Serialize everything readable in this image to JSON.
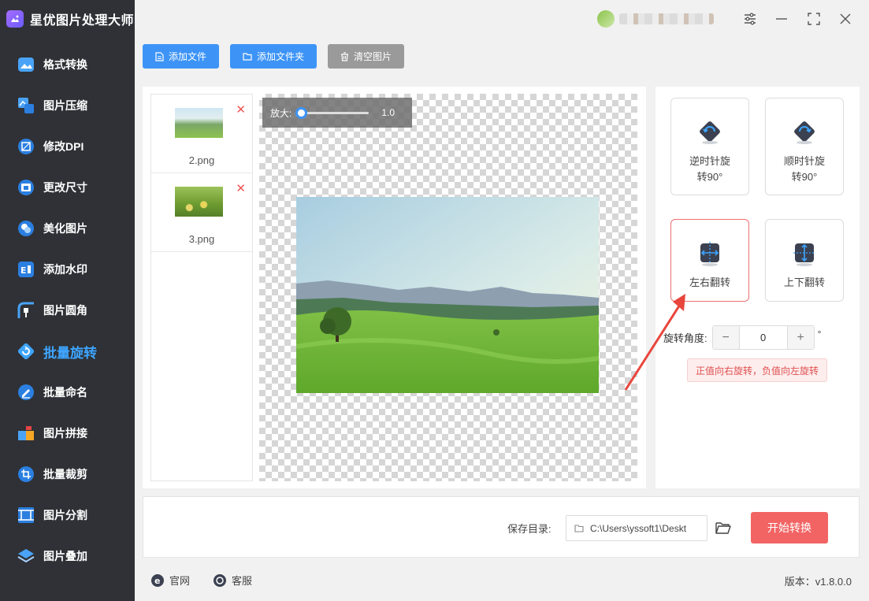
{
  "app": {
    "title": "星优图片处理大师"
  },
  "sidebar": {
    "items": [
      {
        "label": "格式转换",
        "icon": "format-convert-icon"
      },
      {
        "label": "图片压缩",
        "icon": "compress-icon"
      },
      {
        "label": "修改DPI",
        "icon": "dpi-icon"
      },
      {
        "label": "更改尺寸",
        "icon": "resize-icon"
      },
      {
        "label": "美化图片",
        "icon": "beautify-icon"
      },
      {
        "label": "添加水印",
        "icon": "watermark-icon"
      },
      {
        "label": "图片圆角",
        "icon": "round-corner-icon"
      },
      {
        "label": "批量旋转",
        "icon": "rotate-icon",
        "active": true
      },
      {
        "label": "批量命名",
        "icon": "rename-icon"
      },
      {
        "label": "图片拼接",
        "icon": "stitch-icon"
      },
      {
        "label": "批量裁剪",
        "icon": "crop-icon"
      },
      {
        "label": "图片分割",
        "icon": "split-icon"
      },
      {
        "label": "图片叠加",
        "icon": "overlay-icon"
      }
    ]
  },
  "toolbar": {
    "add_file": "添加文件",
    "add_folder": "添加文件夹",
    "clear": "清空图片"
  },
  "files": [
    {
      "name": "2.png"
    },
    {
      "name": "3.png"
    }
  ],
  "preview": {
    "zoom_label": "放大:",
    "zoom_value": "1.0"
  },
  "operations": {
    "rotate_ccw_line1": "逆时针旋",
    "rotate_ccw_line2": "转90°",
    "rotate_cw_line1": "顺时针旋",
    "rotate_cw_line2": "转90°",
    "flip_horizontal": "左右翻转",
    "flip_vertical": "上下翻转",
    "selected": "flip_horizontal"
  },
  "angle": {
    "label": "旋转角度:",
    "value": "0",
    "unit": "°",
    "minus": "−",
    "plus": "+",
    "hint": "正值向右旋转，负值向左旋转"
  },
  "save": {
    "label": "保存目录:",
    "path": "C:\\Users\\yssoft1\\Deskt",
    "start_button": "开始转换"
  },
  "footer": {
    "website": "官网",
    "support": "客服",
    "version": "版本：v1.8.0.0"
  },
  "colors": {
    "accent": "#3d94f6",
    "sidebar_bg": "#2f3136",
    "start": "#f26464",
    "active_nav": "#3ea5ff"
  }
}
